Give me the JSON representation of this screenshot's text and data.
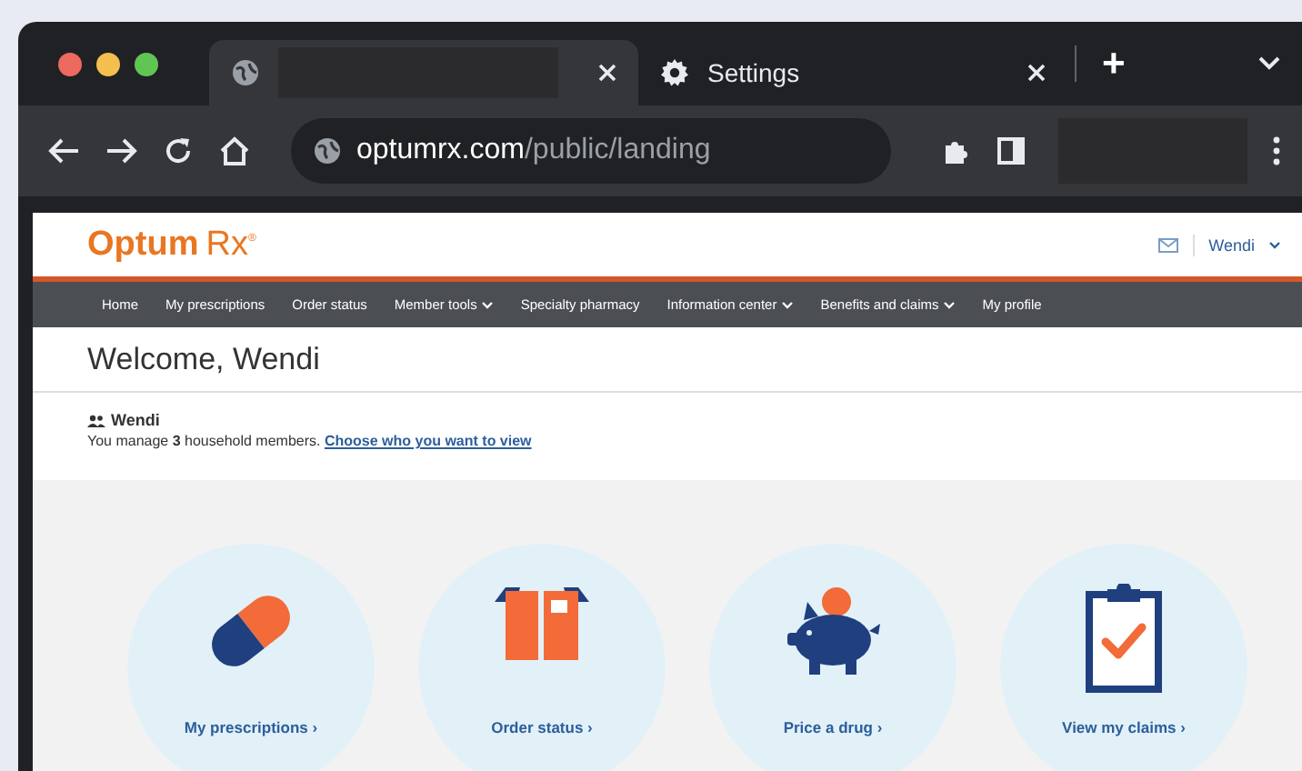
{
  "browser": {
    "tabs": [
      {
        "kind": "redacted",
        "selected": true
      },
      {
        "kind": "settings",
        "title": "Settings",
        "selected": false
      }
    ],
    "new_tab": "+",
    "address": {
      "domain": "optumrx.com",
      "path": "/public/landing"
    }
  },
  "page": {
    "logo": {
      "brand": "Optum",
      "product": "Rx",
      "mark": "®"
    },
    "user": "Wendi",
    "nav": [
      {
        "label": "Home",
        "dropdown": false
      },
      {
        "label": "My prescriptions",
        "dropdown": false
      },
      {
        "label": "Order status",
        "dropdown": false
      },
      {
        "label": "Member tools",
        "dropdown": true
      },
      {
        "label": "Specialty pharmacy",
        "dropdown": false
      },
      {
        "label": "Information center",
        "dropdown": true
      },
      {
        "label": "Benefits and claims",
        "dropdown": true
      },
      {
        "label": "My profile",
        "dropdown": false
      }
    ],
    "welcome": "Welcome, Wendi",
    "household": {
      "name": "Wendi",
      "text": "You manage **3** household members.",
      "link": "Choose who you want to view"
    },
    "tiles": [
      {
        "kind": "pill",
        "label": "My prescriptions ›"
      },
      {
        "kind": "box",
        "label": "Order status ›"
      },
      {
        "kind": "piggy",
        "label": "Price a drug ›"
      },
      {
        "kind": "clipboard",
        "label": "View my claims ›"
      }
    ]
  }
}
